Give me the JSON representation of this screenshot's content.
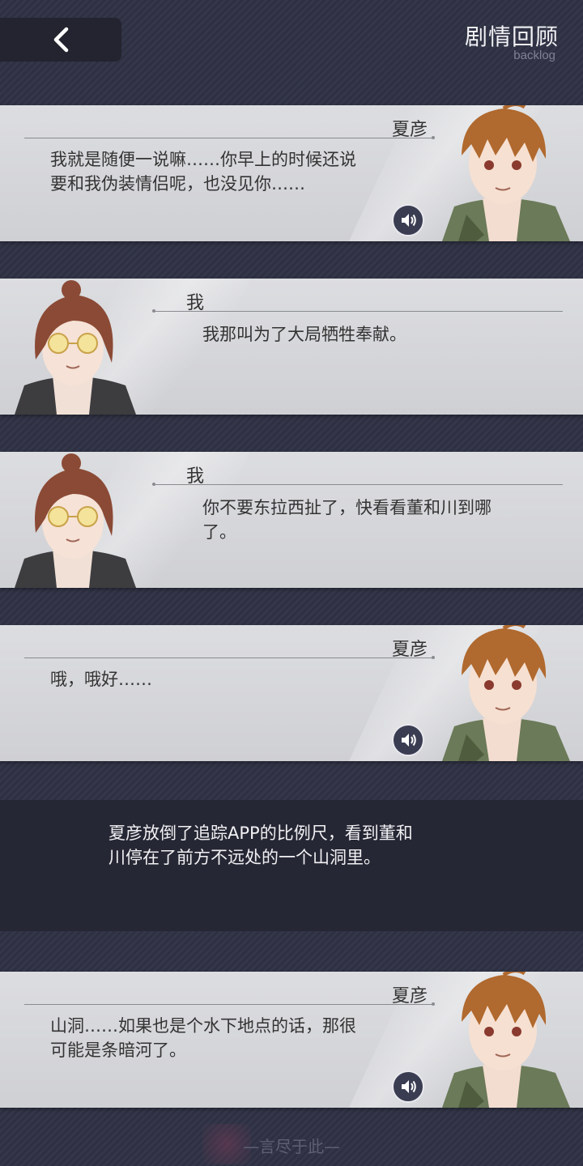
{
  "header": {
    "title": "剧情回顾",
    "subtitle": "backlog"
  },
  "entries": [
    {
      "speaker": "夏彦",
      "text": "我就是随便一说嘛……你早上的时候还说要和我伪装情侣呢，也没见你……",
      "lines": [
        "我就是随便一说嘛……你早上的时候还说",
        "要和我伪装情侣呢，也没见你……"
      ]
    },
    {
      "speaker": "我",
      "lines": [
        "我那叫为了大局牺牲奉献。"
      ]
    },
    {
      "speaker": "我",
      "lines": [
        "你不要东拉西扯了，快看看董和川到哪",
        "了。"
      ]
    },
    {
      "speaker": "夏彦",
      "lines": [
        "哦，哦好……"
      ]
    },
    {
      "speaker": "夏彦",
      "lines": [
        "山洞……如果也是个水下地点的话，那很",
        "可能是条暗河了。"
      ]
    }
  ],
  "narration": {
    "lines": [
      "夏彦放倒了追踪APP的比例尺，看到董和",
      "川停在了前方不远处的一个山洞里。"
    ]
  },
  "footer": {
    "end_text": "—言尽于此—"
  },
  "icons": {
    "back": "chevron-left-icon",
    "voice": "speaker-icon"
  },
  "colors": {
    "background": "#2e3042",
    "card": "#d6d7da",
    "narration_band": "#262734"
  }
}
